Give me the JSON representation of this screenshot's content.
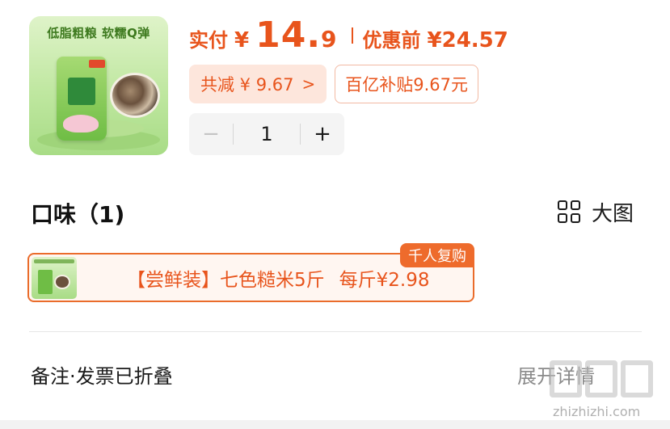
{
  "product": {
    "thumbnail_slogan": "低脂粗粮 软糯Q弹",
    "thumbnail_icon": "product-image"
  },
  "price": {
    "paid_label": "实付",
    "currency": "¥",
    "paid_integer": "14.",
    "paid_decimal": "9",
    "original_label": "优惠前",
    "original_price": "¥24.57",
    "accent_color": "#e8541c"
  },
  "discounts": {
    "total_label": "共减 ¥ 9.67",
    "total_chevron": ">",
    "subsidy_label": "百亿补贴9.67元"
  },
  "quantity": {
    "minus": "−",
    "value": "1",
    "plus": "+"
  },
  "flavor": {
    "title": "口味（1)",
    "big_view_label": "大图",
    "big_view_icon": "grid-icon"
  },
  "option": {
    "name": "【尝鲜装】七色糙米5斤",
    "unit_price": "每斤¥2.98",
    "badge": "千人复购",
    "selected": true
  },
  "remarks": {
    "label": "备注·发票已折叠",
    "expand_label": "展开详情"
  },
  "watermark": {
    "logo": "值值值",
    "url": "zhizhizhi.com"
  }
}
